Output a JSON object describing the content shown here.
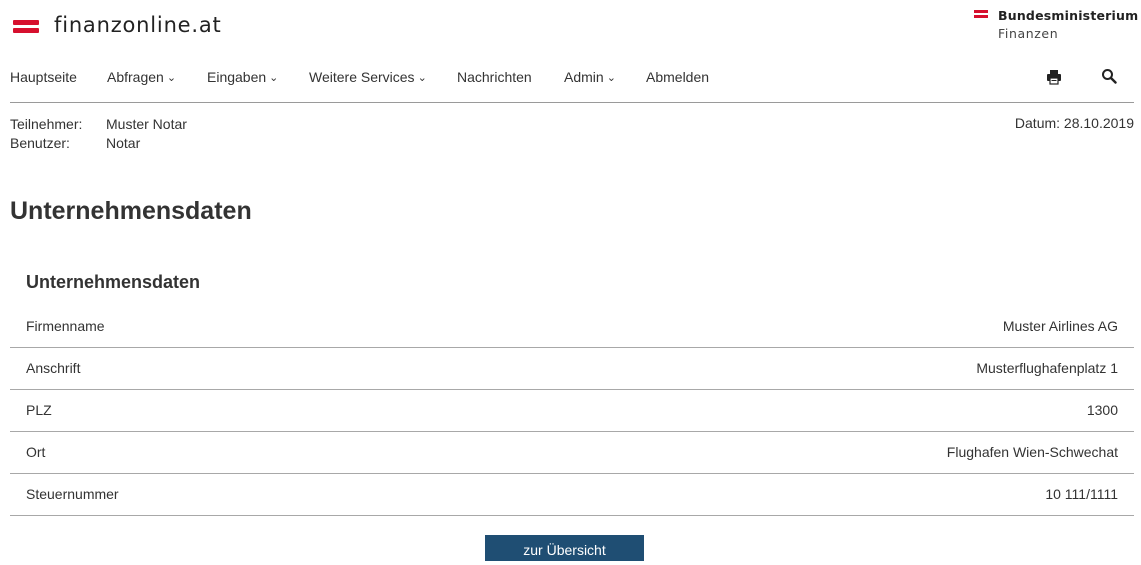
{
  "colors": {
    "brand_red": "#d6102e",
    "button_bg": "#1f4e73",
    "text": "#333333",
    "divider": "#a8a8a8"
  },
  "header": {
    "logo_text": "finanzonline.at",
    "ministry_title": "Bundesministerium",
    "ministry_subtitle": "Finanzen"
  },
  "nav": {
    "items": [
      {
        "label": "Hauptseite",
        "has_dropdown": false
      },
      {
        "label": "Abfragen",
        "has_dropdown": true
      },
      {
        "label": "Eingaben",
        "has_dropdown": true
      },
      {
        "label": "Weitere Services",
        "has_dropdown": true
      },
      {
        "label": "Nachrichten",
        "has_dropdown": false
      },
      {
        "label": "Admin",
        "has_dropdown": true
      },
      {
        "label": "Abmelden",
        "has_dropdown": false
      }
    ],
    "icons": [
      "print-icon",
      "search-icon"
    ]
  },
  "session": {
    "teilnehmer_label": "Teilnehmer:",
    "teilnehmer_value": "Muster Notar",
    "benutzer_label": "Benutzer:",
    "benutzer_value": "Notar",
    "datum": "Datum: 28.10.2019"
  },
  "page_title": "Unternehmensdaten",
  "section": {
    "title": "Unternehmensdaten",
    "rows": [
      {
        "label": "Firmenname",
        "value": "Muster Airlines AG"
      },
      {
        "label": "Anschrift",
        "value": "Musterflughafenplatz 1"
      },
      {
        "label": "PLZ",
        "value": "1300"
      },
      {
        "label": "Ort",
        "value": "Flughafen Wien-Schwechat"
      },
      {
        "label": "Steuernummer",
        "value": "10 111/1111"
      }
    ]
  },
  "button": {
    "label": "zur Übersicht"
  }
}
